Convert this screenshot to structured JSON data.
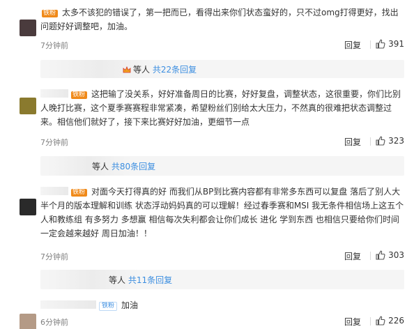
{
  "comments": [
    {
      "fan_badge": "铁粉",
      "text": "太多不该犯的错误了，第一把而已，看得出来你们状态蛮好的，只不过omg打得更好，找出问题好好调整吧，加油。",
      "time": "7分钟前",
      "reply_label": "回复",
      "likes": "391",
      "replies": {
        "prefix": "等人",
        "count_text": "共22条回复"
      }
    },
    {
      "fan_badge": "铁粉",
      "text": "这把输了没关系，好好准备周日的比赛，好好复盘，调整状态，这很重要，你们比别人晚打比赛，这个夏季赛赛程非常紧凑，希望粉丝们别给太大压力，不然真的很难把状态调整过来。相信他们就好了，接下来比赛好好加油，更细节一点",
      "time": "7分钟前",
      "reply_label": "回复",
      "likes": "323",
      "replies": {
        "prefix": "等人",
        "count_text": "共80条回复"
      }
    },
    {
      "fan_badge": "铁粉",
      "text": "对面今天打得真的好 而我们从BP到比赛内容都有非常多东西可以复盘 落后了别人大半个月的版本理解和训练 状态浮动妈妈真的可以理解！经过春季赛和MSI 我无条件相信场上这五个人和教练组 有多努力 多想赢 相信每次失利都会让你们成长 进化 学到东西 也相信只要给你们时间 一定会越来越好 周日加油！！",
      "time": "7分钟前",
      "reply_label": "回复",
      "likes": "303",
      "replies": {
        "prefix": "等人",
        "count_text": "共11条回复"
      }
    },
    {
      "fan_badge": "铁粉",
      "text": "加油",
      "time": "6分钟前",
      "reply_label": "回复",
      "likes": "226"
    }
  ],
  "colors": {
    "accent": "#3c8ee0",
    "fan_badge": "#f08a1a",
    "text": "#333333",
    "meta": "#808080"
  },
  "icons": {
    "like": "thumbs-up-icon",
    "crown": "crown-icon"
  }
}
